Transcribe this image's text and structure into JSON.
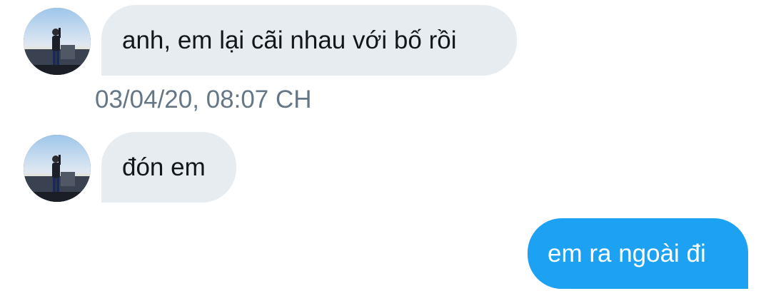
{
  "conversation": {
    "messages": [
      {
        "direction": "received",
        "text": "anh, em lại cãi nhau với bố rồi"
      },
      {
        "direction": "received",
        "text": "đón em"
      },
      {
        "direction": "sent",
        "text": "em ra ngoài đi"
      }
    ],
    "timestamp": "03/04/20, 08:07 CH"
  },
  "colors": {
    "received_bubble": "#e6ecf0",
    "sent_bubble": "#1da1f2",
    "timestamp_text": "#657786",
    "message_text": "#14171a"
  },
  "icons": {
    "avatar": "user-avatar-photo"
  }
}
